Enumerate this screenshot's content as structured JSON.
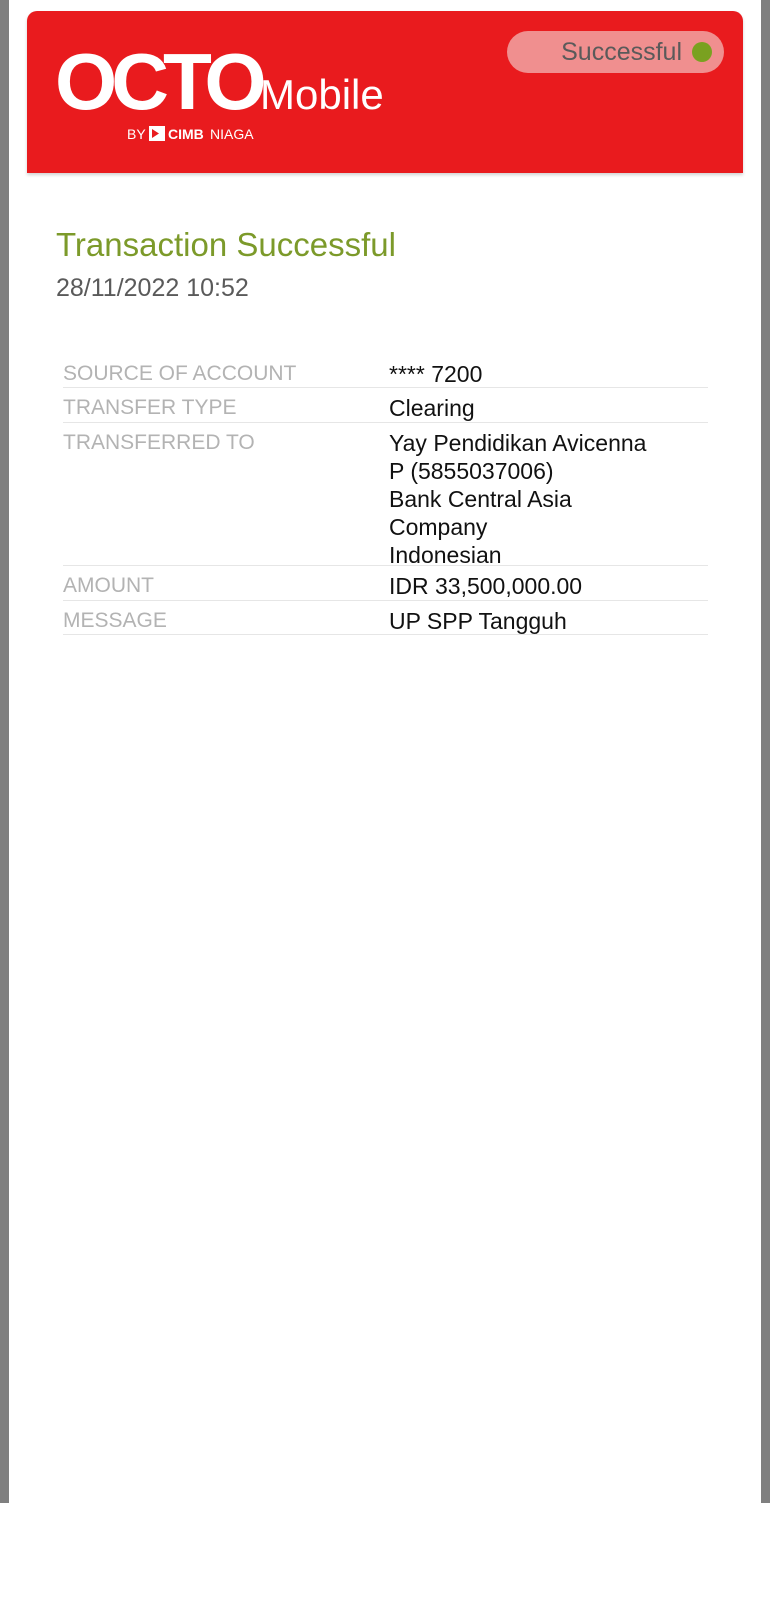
{
  "brand": {
    "logo_main": "OCTO",
    "logo_sub": "Mobile",
    "by_label": "BY",
    "bank_name": "CIMB",
    "bank_suffix": "NIAGA",
    "header_color": "#e91b1e"
  },
  "status_badge": {
    "label": "Successful",
    "dot_color": "#7aa120"
  },
  "transaction": {
    "title": "Transaction Successful",
    "datetime": "28/11/2022 10:52"
  },
  "details": {
    "source": {
      "label": "SOURCE OF ACCOUNT",
      "value": "**** 7200"
    },
    "transfer_type": {
      "label": "TRANSFER TYPE",
      "value": "Clearing"
    },
    "transferred_to": {
      "label": "TRANSFERRED TO",
      "lines": [
        "Yay Pendidikan Avicenna",
        "P (5855037006)",
        "Bank Central Asia",
        "Company",
        "Indonesian"
      ]
    },
    "amount": {
      "label": "AMOUNT",
      "value": "IDR 33,500,000.00"
    },
    "message": {
      "label": "MESSAGE",
      "value": "UP SPP Tangguh"
    }
  }
}
